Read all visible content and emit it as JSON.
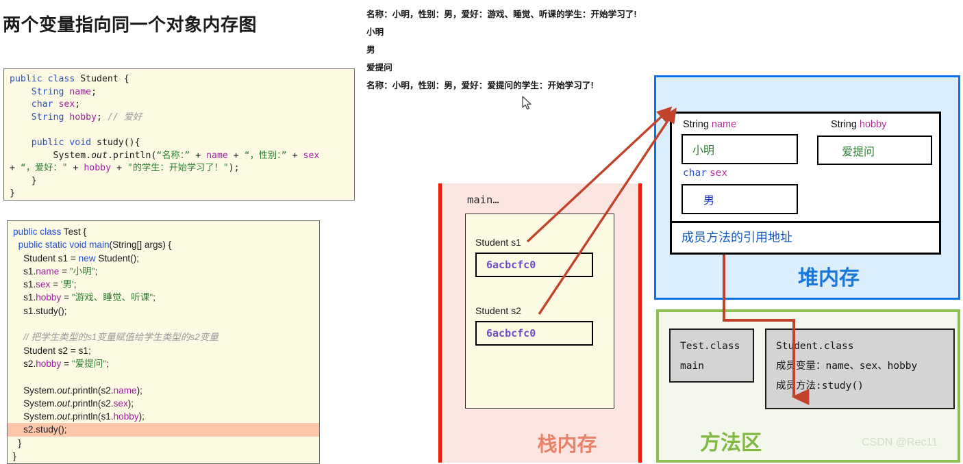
{
  "title": "两个变量指向同一个对象内存图",
  "console": {
    "lines": [
      "名称：小明，性别：男，爱好：游戏、睡觉、听课的学生：开始学习了!",
      "小明",
      "男",
      "爱提问",
      "名称：小明，性别：男，爱好：爱提问的学生：开始学习了!"
    ]
  },
  "code_student": {
    "l1_a": "public",
    "l1_b": "class",
    "l1_c": " Student {",
    "l2_a": "String",
    "l2_b": " name",
    "l2_c": ";",
    "l3_a": "char",
    "l3_b": " sex",
    "l3_c": ";",
    "l4_a": "String",
    "l4_b": " hobby",
    "l4_c": "; ",
    "l4_d": "// 爱好",
    "l5": "",
    "l6_a": "public",
    "l6_b": " void",
    "l6_c": " study(){",
    "l7_a": "System.",
    "l7_b": "out",
    "l7_c": ".println(",
    "l7_d": "“名称：”",
    "l7_e": " + ",
    "l7_f": "name",
    "l7_g": " + ",
    "l7_h": "“，性别：”",
    "l7_i": " + ",
    "l7_j": "sex",
    "l8_a": "+ ",
    "l8_b": "“，爱好：\"",
    "l8_c": " + ",
    "l8_d": "hobby",
    "l8_e": " + ",
    "l8_f": "\"的学生：开始学习了！\"",
    "l8_g": ");",
    "l9": "    }",
    "l10": "}"
  },
  "code_test": {
    "l1_a": "public class",
    "l1_b": " Test {",
    "l2_a": "public static void main",
    "l2_b": "(String[] args) {",
    "l3_a": "Student s1 = ",
    "l3_b": "new",
    "l3_c": " Student();",
    "l4_a": "s1.",
    "l4_b": "name",
    "l4_c": " = ",
    "l4_d": "\"小明\"",
    "l4_e": ";",
    "l5_a": "s1.",
    "l5_b": "sex",
    "l5_c": " = ",
    "l5_d": "'男'",
    "l5_e": ";",
    "l6_a": "s1.",
    "l6_b": "hobby",
    "l6_c": " = ",
    "l6_d": "\"游戏、睡觉、听课\"",
    "l6_e": ";",
    "l7": "s1.study();",
    "l8": "",
    "l9": "// 把学生类型的s1变量赋值给学生类型的s2变量",
    "l10": "Student s2 = s1;",
    "l11_a": "s2.",
    "l11_b": "hobby",
    "l11_c": " = ",
    "l11_d": "\"爱提问\"",
    "l11_e": ";",
    "l12": "",
    "l13_a": "System.",
    "l13_b": "out",
    "l13_c": ".println(s2.",
    "l13_d": "name",
    "l13_e": ");",
    "l14_a": "System.",
    "l14_b": "out",
    "l14_c": ".println(s2.",
    "l14_d": "sex",
    "l14_e": ");",
    "l15_a": "System.",
    "l15_b": "out",
    "l15_c": ".println(s1.",
    "l15_d": "hobby",
    "l15_e": ");",
    "l16": "s2.study();",
    "l17": "  }",
    "l18": "}"
  },
  "stack": {
    "region_label": "栈内存",
    "frame_label": "main…",
    "vars": [
      {
        "label": "Student s1",
        "value": "6acbcfc0"
      },
      {
        "label": "Student s2",
        "value": "6acbcfc0"
      }
    ]
  },
  "heap": {
    "region_label": "堆内存",
    "fields": [
      {
        "type": "String",
        "name": "name",
        "value": "小明"
      },
      {
        "type": "String",
        "name": "hobby",
        "value": "爱提问"
      },
      {
        "type": "char",
        "name": "sex",
        "value": "男"
      }
    ],
    "method_ref": "成员方法的引用地址"
  },
  "method_area": {
    "region_label": "方法区",
    "test_class": {
      "name": "Test.class",
      "member": "main"
    },
    "student_class": {
      "name": "Student.class",
      "fields": "成员变量：name、sex、hobby",
      "methods": "成员方法:study()"
    }
  },
  "watermark": "CSDN @Rec11",
  "colors": {
    "stack_border": "#f01a08",
    "stack_fill": "#fbe5e0",
    "stack_label": "#e8836a",
    "heap_border": "#0b72e8",
    "heap_fill": "#dceefb",
    "heap_label": "#1877d8",
    "method_border": "#8cc152",
    "method_fill": "#f4f8ec",
    "method_label": "#7fb93f",
    "arrow": "#c0432a",
    "code_bg": "#fdfae4",
    "highlight": "#fbc7a8"
  }
}
